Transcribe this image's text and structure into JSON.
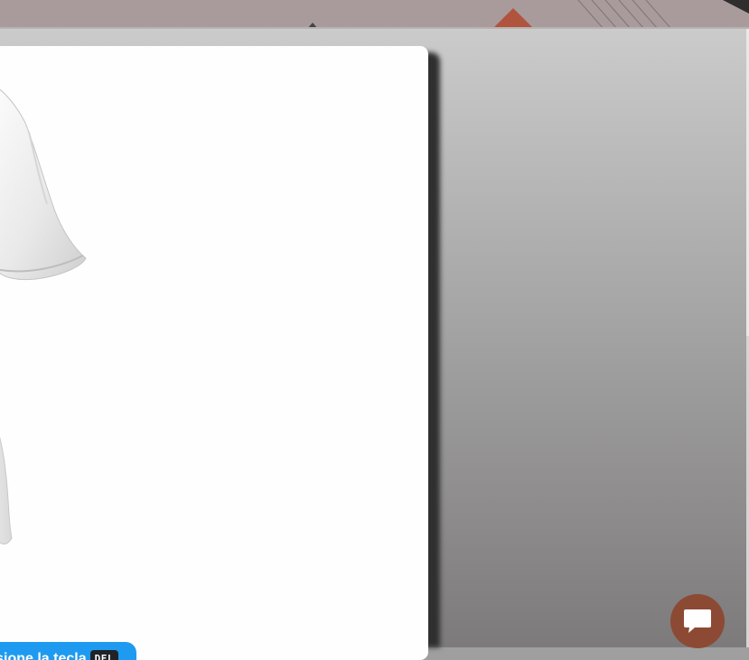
{
  "colors": {
    "hint_background": "#1e9bf0",
    "chat_button": "#8c4a35",
    "top_strip": "#a99b9b",
    "accent_triangle": "#b1543e"
  },
  "hint": {
    "text": "resione la tecla",
    "key": "DEL",
    "suffix": "."
  },
  "icons": {
    "chat": "chat-bubble-icon",
    "product": "white-tshirt-image"
  }
}
